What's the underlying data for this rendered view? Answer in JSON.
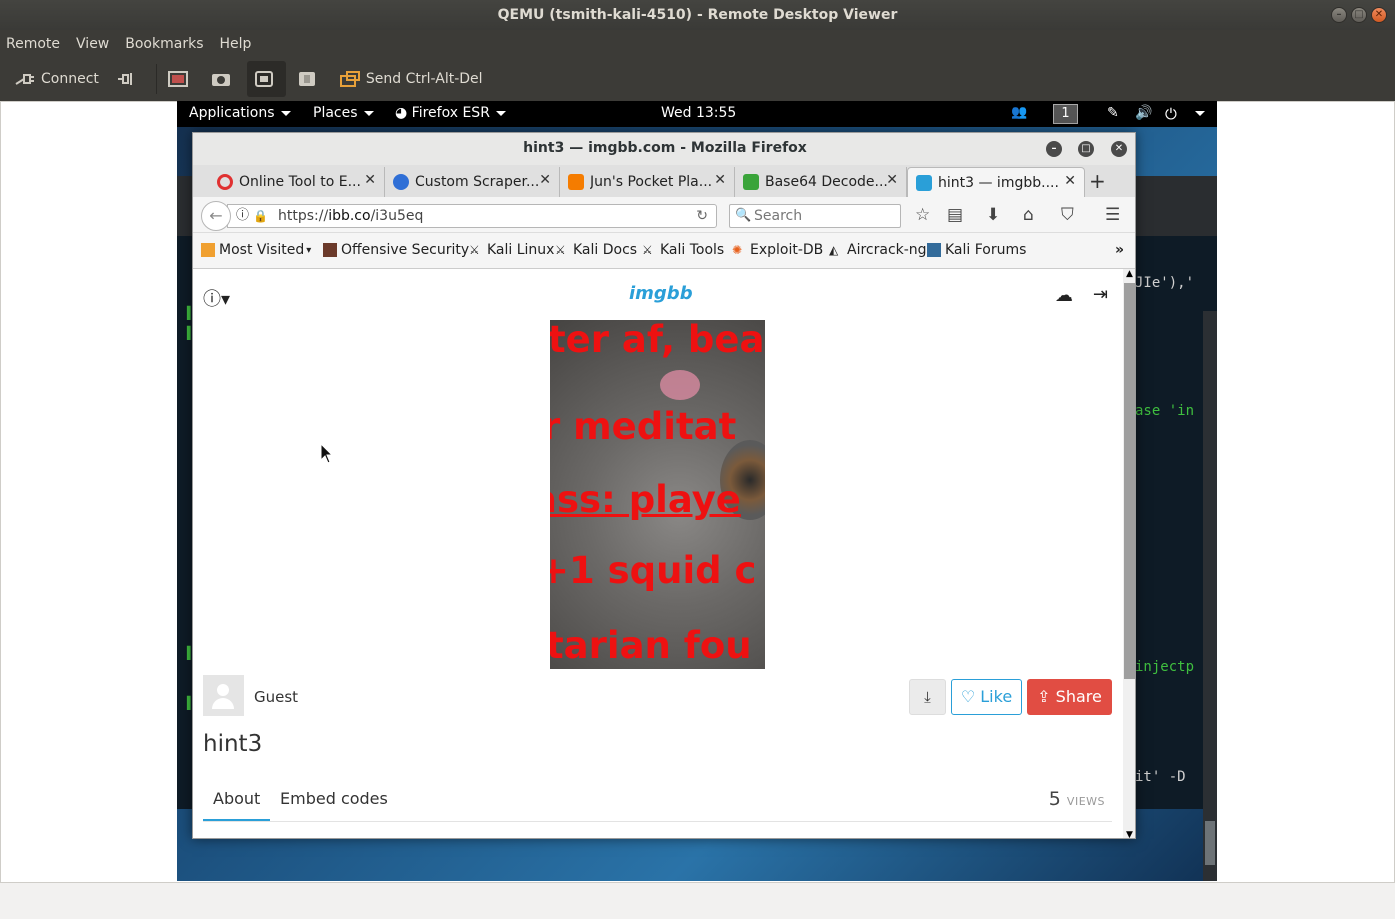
{
  "outer_window": {
    "title": "QEMU (tsmith-kali-4510) - Remote Desktop Viewer",
    "menu": [
      "Remote",
      "View",
      "Bookmarks",
      "Help"
    ],
    "toolbar": {
      "connect_label": "Connect",
      "send_cad_label": "Send Ctrl-Alt-Del"
    }
  },
  "kali_panel": {
    "applications": "Applications",
    "places": "Places",
    "firefox_esr": "Firefox ESR",
    "clock": "Wed 13:55",
    "workspace": "1"
  },
  "terminal": {
    "lines": [
      "JIe'),'",
      "ase 'in",
      "injectp",
      "it' -D"
    ]
  },
  "firefox": {
    "window_title": "hint3 — imgbb.com - Mozilla Firefox",
    "tabs": [
      {
        "label": "Online Tool to E...",
        "color": "#e03131"
      },
      {
        "label": "Custom Scraper...",
        "color": "#2f6fd6"
      },
      {
        "label": "Jun's Pocket Pla...",
        "color": "#f57c00"
      },
      {
        "label": "Base64 Decode...",
        "color": "#3aa43a"
      },
      {
        "label": "hint3 — imgbb....",
        "color": "#2a9fd8"
      }
    ],
    "url_prefix": "https://",
    "url_domain": "ibb.co",
    "url_path": "/i3u5eq",
    "search_placeholder": "Search",
    "bookmarks": [
      "Most Visited",
      "Offensive Security",
      "Kali Linux",
      "Kali Docs",
      "Kali Tools",
      "Exploit-DB",
      "Aircrack-ng",
      "Kali Forums"
    ]
  },
  "page": {
    "logo": "imgbb",
    "image_text_lines": [
      "ter af, bea",
      "r meditat",
      "ass: playe",
      "+1 squid c",
      "tarian fou"
    ],
    "uploader": "Guest",
    "like_label": "Like",
    "share_label": "Share",
    "image_title": "hint3",
    "tabs": [
      "About",
      "Embed codes"
    ],
    "views_count": "5",
    "views_label": "VIEWS"
  }
}
